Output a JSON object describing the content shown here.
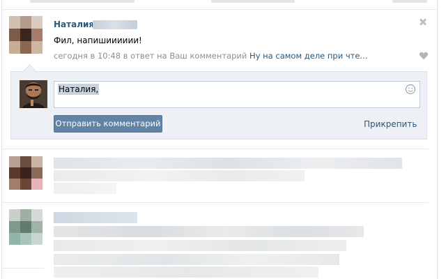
{
  "colors": {
    "link": "#2b587a",
    "meta": "#8b8f94",
    "button_bg": "#6183a6",
    "reply_bg": "#edf1f5"
  },
  "comment": {
    "author": "Наталия",
    "text": "Фил, напишииииии!",
    "time": "сегодня в 10:48",
    "reply_prefix": "в ответ на Ваш комментарий",
    "reply_link": "Ну на самом деле при чте...",
    "close_icon": "✖",
    "like_icon": "heart-icon"
  },
  "reply_form": {
    "input_value": "Наталия,",
    "smiley_icon": "smiley-icon",
    "send_label": "Отправить комментарий",
    "attach_label": "Прикрепить"
  }
}
